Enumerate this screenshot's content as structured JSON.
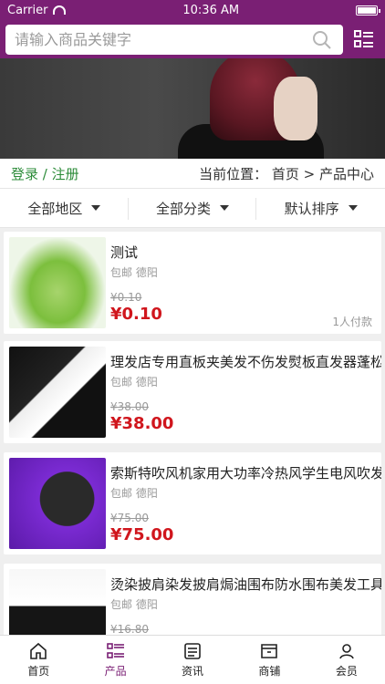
{
  "status": {
    "carrier": "Carrier",
    "time": "10:36 AM"
  },
  "search": {
    "placeholder": "请输入商品关键字"
  },
  "location": {
    "login": "登录 / 注册",
    "breadcrumb": "当前位置： 首页 > 产品中心"
  },
  "filters": [
    {
      "label": "全部地区"
    },
    {
      "label": "全部分类"
    },
    {
      "label": "默认排序"
    }
  ],
  "products": [
    {
      "title": "测试",
      "shipping": "包邮 德阳",
      "old_price": "¥0.10",
      "price": "¥0.10",
      "paid": "1人付款"
    },
    {
      "title": "理发店专用直板夹美发不伤发熨板直发器蓬松",
      "shipping": "包邮 德阳",
      "old_price": "¥38.00",
      "price": "¥38.00",
      "paid": ""
    },
    {
      "title": "索斯特吹风机家用大功率冷热风学生电风吹发",
      "shipping": "包邮 德阳",
      "old_price": "¥75.00",
      "price": "¥75.00",
      "paid": ""
    },
    {
      "title": "烫染披肩染发披肩焗油围布防水围布美发工具",
      "shipping": "包邮 德阳",
      "old_price": "¥16.80",
      "price": "",
      "paid": ""
    }
  ],
  "tabs": [
    {
      "label": "首页",
      "icon": "home-icon",
      "active": false
    },
    {
      "label": "产品",
      "icon": "list-icon",
      "active": true
    },
    {
      "label": "资讯",
      "icon": "news-icon",
      "active": false
    },
    {
      "label": "商铺",
      "icon": "store-icon",
      "active": false
    },
    {
      "label": "会员",
      "icon": "user-icon",
      "active": false
    }
  ],
  "colors": {
    "brand": "#7a1f74",
    "price": "#d0161d",
    "login": "#2d8c3a"
  }
}
